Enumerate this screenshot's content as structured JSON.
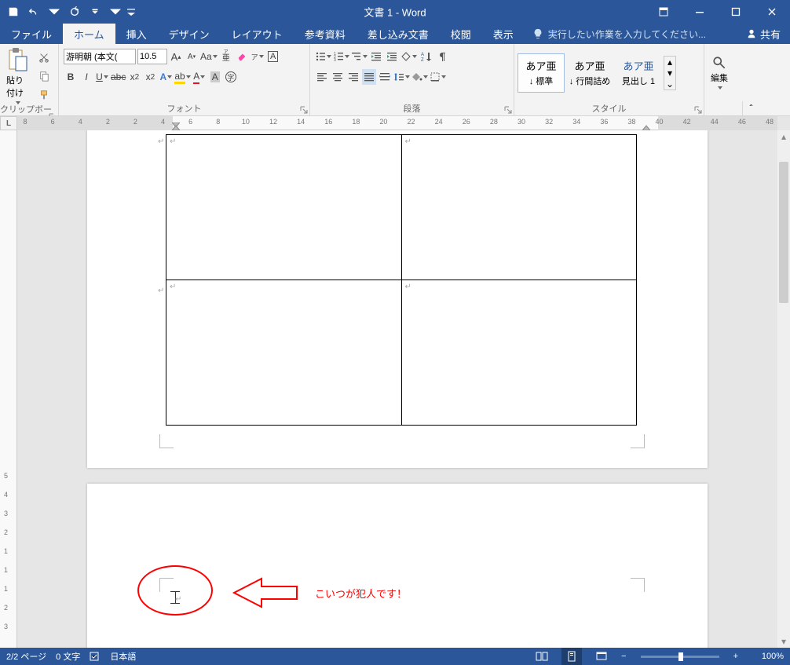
{
  "titlebar": {
    "doc_title": "文書 1 - Word"
  },
  "tabs": {
    "file": "ファイル",
    "home": "ホーム",
    "insert": "挿入",
    "design": "デザイン",
    "layout": "レイアウト",
    "references": "参考資料",
    "mailings": "差し込み文書",
    "review": "校閲",
    "view": "表示",
    "tellme": "実行したい作業を入力してください...",
    "share": "共有"
  },
  "ribbon": {
    "clipboard": {
      "label": "クリップボード",
      "paste": "貼り付け"
    },
    "font": {
      "label": "フォント",
      "name": "游明朝 (本文(",
      "size": "10.5"
    },
    "paragraph": {
      "label": "段落"
    },
    "styles": {
      "label": "スタイル",
      "items": [
        {
          "sample": "あア亜",
          "name": "↓ 標準"
        },
        {
          "sample": "あア亜",
          "name": "↓ 行間詰め"
        },
        {
          "sample": "あア亜",
          "name": "見出し 1"
        }
      ]
    },
    "editing": {
      "label": "編集"
    }
  },
  "ruler": {
    "h": [
      "8",
      "6",
      "4",
      "2",
      "2",
      "4",
      "6",
      "8",
      "10",
      "12",
      "14",
      "16",
      "18",
      "20",
      "22",
      "24",
      "26",
      "28",
      "30",
      "32",
      "34",
      "36",
      "38",
      "40",
      "42",
      "44",
      "46",
      "48"
    ],
    "v": [
      "5",
      "4",
      "3",
      "2",
      "1",
      "1",
      "1",
      "2",
      "3"
    ],
    "tabsel": "L"
  },
  "annotation": {
    "text": "こいつが犯人です！"
  },
  "status": {
    "page": "2/2 ページ",
    "words": "0 文字",
    "lang": "日本語",
    "zoom": "100%"
  }
}
